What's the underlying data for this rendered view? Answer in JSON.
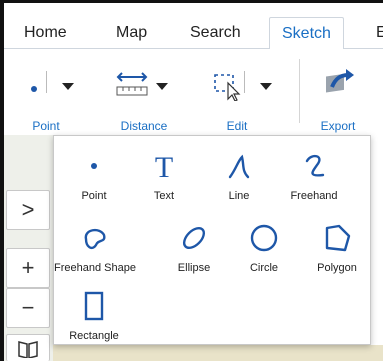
{
  "tabs": [
    {
      "label": "Home"
    },
    {
      "label": "Map"
    },
    {
      "label": "Search"
    },
    {
      "label": "Sketch"
    },
    {
      "label": "E"
    }
  ],
  "ribbon": {
    "point": "Point",
    "distance": "Distance",
    "edit": "Edit",
    "export": "Export"
  },
  "sketch_menu": {
    "items": [
      {
        "label": "Point",
        "icon": "dot-icon"
      },
      {
        "label": "Text",
        "icon": "text-icon"
      },
      {
        "label": "Line",
        "icon": "line-icon"
      },
      {
        "label": "Freehand",
        "icon": "freehand-icon"
      },
      {
        "label": "Freehand Shape",
        "icon": "freehand-shape-icon"
      },
      {
        "label": "Ellipse",
        "icon": "ellipse-icon"
      },
      {
        "label": "Circle",
        "icon": "circle-icon"
      },
      {
        "label": "Polygon",
        "icon": "polygon-icon"
      },
      {
        "label": "Rectangle",
        "icon": "rectangle-icon"
      }
    ]
  },
  "map_controls": {
    "expand": ">",
    "zoom_in": "+",
    "zoom_out": "−"
  },
  "colors": {
    "accent": "#1a6fc4",
    "icon_blue": "#1e57a8"
  }
}
